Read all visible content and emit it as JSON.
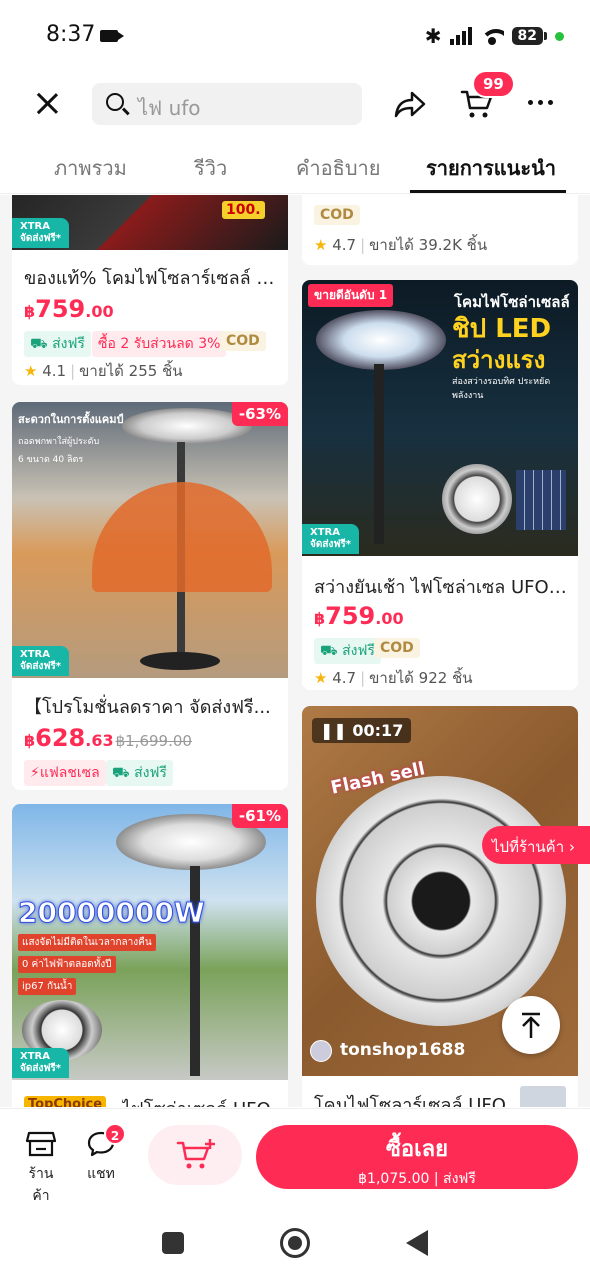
{
  "status_bar": {
    "time": "8:37",
    "battery": "82"
  },
  "header": {
    "search_value": "ไฟ ufo",
    "cart_count": "99"
  },
  "tabs": [
    {
      "label": "ภาพรวม"
    },
    {
      "label": "รีวิว"
    },
    {
      "label": "คำอธิบาย"
    },
    {
      "label": "รายการแนะนำ"
    }
  ],
  "products": [
    {
      "title": "ของแท้% โคมไฟโซลาร์เซลล์ UF...",
      "price_int": "759",
      "price_dec": ".00",
      "chips": [
        "ส่งฟรี",
        "ซื้อ 2 รับส่วนลด 3%",
        "COD"
      ],
      "rating": "4.1",
      "sold": "ขายได้ 255 ชิ้น",
      "banner_price": "100.",
      "xtra_line1": "XTRA",
      "xtra_line2": "จัดส่งฟรี*"
    },
    {
      "cod": "COD",
      "rating": "4.7",
      "sold": "ขายได้ 39.2K ชิ้น"
    },
    {
      "title": "สว่างยันเช้า ไฟโซล่าเซล UFO S...",
      "price_int": "759",
      "price_dec": ".00",
      "chips": [
        "ส่งฟรี",
        "COD"
      ],
      "rating": "4.7",
      "sold": "ขายได้ 922 ชิ้น",
      "img_badge": "ขายดีอันดับ 1",
      "img_line1": "โคมไฟโซล่าเซลล์",
      "img_line2": "ชิป LED",
      "img_line3": "สว่างแรง",
      "img_line4": "ส่องสว่างรอบทิศ ประหยัดพลังงาน",
      "xtra_line1": "XTRA",
      "xtra_line2": "จัดส่งฟรี*"
    },
    {
      "title": "【โปรโมชั่นลดราคา จัดส่งฟรี...",
      "price_int": "628",
      "price_dec": ".63",
      "old_price": "฿1,699.00",
      "discount": "-63%",
      "chips": [
        "แฟลชเซล",
        "ส่งฟรี"
      ],
      "img_line1": "สะดวกในการตั้งแคมป์",
      "img_line2": "ถอดพกพาใส่ผู้ประดับ",
      "img_line3": "6 ขนาด 40 ลิตร",
      "xtra_line1": "XTRA",
      "xtra_line2": "จัดส่งฟรี*"
    },
    {
      "video_time": "00:17",
      "img_text": "Flash sell",
      "shop": "tonshop1688",
      "title": "โคมไฟโซลาร์เซลล์ UFO"
    },
    {
      "discount": "-61%",
      "img_watt": "20000000W",
      "img_line1": "แสงจัดไม่มีติดในเวลากลางคืน",
      "img_line2": "0 ค่าไฟฟ้าตลอดทั้งปี",
      "img_line3": "ip67 กันน้ำ",
      "brand": "TopChoice",
      "title_partial": "ไฟโซล่าเซลล์ UFO",
      "xtra_line1": "XTRA",
      "xtra_line2": "จัดส่งฟรี*"
    }
  ],
  "floating": {
    "goto_shop": "ไปที่ร้านค้า"
  },
  "bottom_bar": {
    "shop_label": "ร้านค้า",
    "chat_label": "แชท",
    "chat_badge": "2",
    "buy_label": "ซื้อเลย",
    "buy_price": "฿1,075.00",
    "buy_free": "ส่งฟรี"
  },
  "colors": {
    "accent": "#fe2c55",
    "teal": "#17b6a7",
    "free_ship": "#1aa37a",
    "cod": "#b08a40"
  }
}
